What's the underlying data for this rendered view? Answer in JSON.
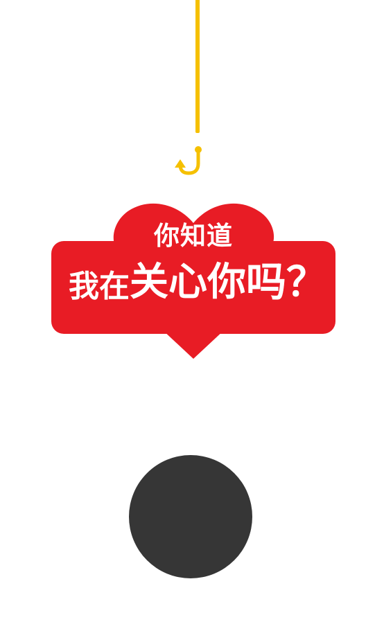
{
  "badge": {
    "line1": "你知道",
    "line2_a": "我在",
    "line2_b": "关心你",
    "line2_c": "吗？"
  },
  "icons": {
    "hook": "fishing-hook-icon",
    "ball": "ball-icon"
  },
  "colors": {
    "badge_red": "#e81c25",
    "hook_yellow": "#f5c000",
    "ball_dark": "#363636",
    "text_white": "#ffffff"
  }
}
